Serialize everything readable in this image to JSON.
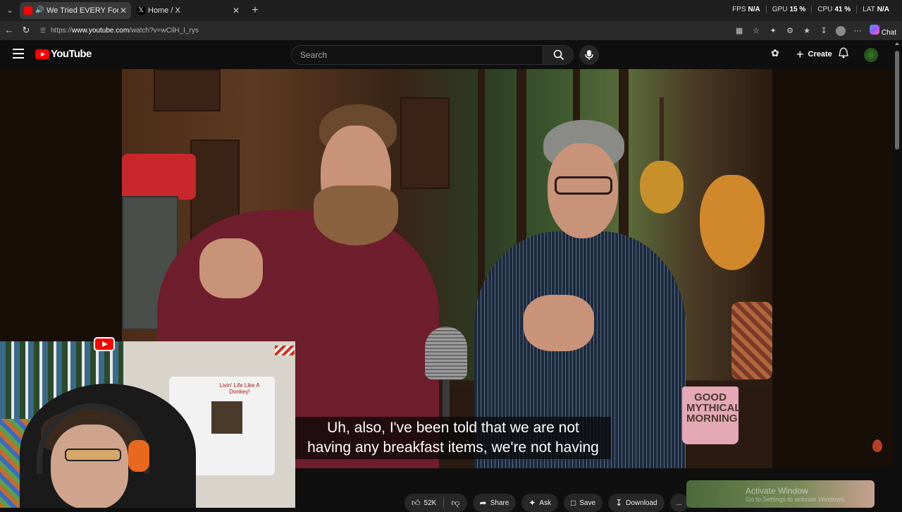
{
  "browser": {
    "tabs": [
      {
        "title": "We Tried EVERY Food At Taco",
        "active": true
      },
      {
        "title": "Home / X",
        "active": false
      }
    ],
    "url_prefix": "https://",
    "url_domain": "www.youtube.com",
    "url_path": "/watch?v=wCilH_I_rys",
    "chat_label": "Chat",
    "stats": [
      {
        "label": "FPS",
        "value": "N/A"
      },
      {
        "label": "GPU",
        "value": "15 %"
      },
      {
        "label": "CPU",
        "value": "41 %"
      },
      {
        "label": "LAT",
        "value": "N/A"
      }
    ]
  },
  "youtube": {
    "logo_text": "YouTube",
    "search_placeholder": "Search",
    "create_label": "Create"
  },
  "video": {
    "caption_line1": "Uh, also, I've been told that we are not",
    "caption_line2": "having any breakfast items, we're not having",
    "mug_text": "GOOD MYTHICAL MORNING",
    "shirt_text": "Livin' Life Like A Donkey!"
  },
  "actions": {
    "like_count": "52K",
    "share_label": "Share",
    "ask_label": "Ask",
    "save_label": "Save",
    "download_label": "Download",
    "more_label": "..."
  },
  "recommendation": {
    "overlay_title": "Activate Window",
    "overlay_sub": "Go to Settings to activate Windows."
  },
  "icons": {
    "tab_list": "chevron-down-icon",
    "back": "back-arrow-icon",
    "reload": "reload-icon",
    "search": "search-icon",
    "mic": "mic-icon",
    "bell": "bell-icon"
  },
  "colors": {
    "yt_red": "#ff0000",
    "bg": "#0f0f0f"
  }
}
